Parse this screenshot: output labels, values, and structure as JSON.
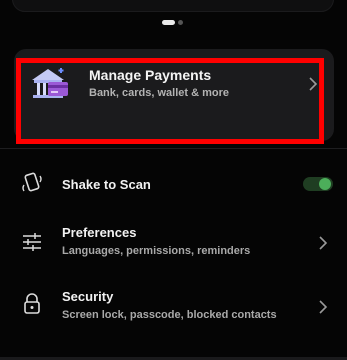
{
  "payments": {
    "title": "Manage Payments",
    "subtitle": "Bank, cards, wallet & more"
  },
  "settings": {
    "shake": {
      "label": "Shake to Scan",
      "enabled": true,
      "icon": "phone-shake-icon"
    },
    "preferences": {
      "label": "Preferences",
      "subtitle": "Languages, permissions, reminders",
      "icon": "sliders-icon"
    },
    "security": {
      "label": "Security",
      "subtitle": "Screen lock, passcode, blocked contacts",
      "icon": "lock-icon"
    }
  },
  "colors": {
    "background": "#050505",
    "card": "#1b1b1d",
    "highlight": "#ff0000",
    "toggle_on": "#4cae5a"
  }
}
